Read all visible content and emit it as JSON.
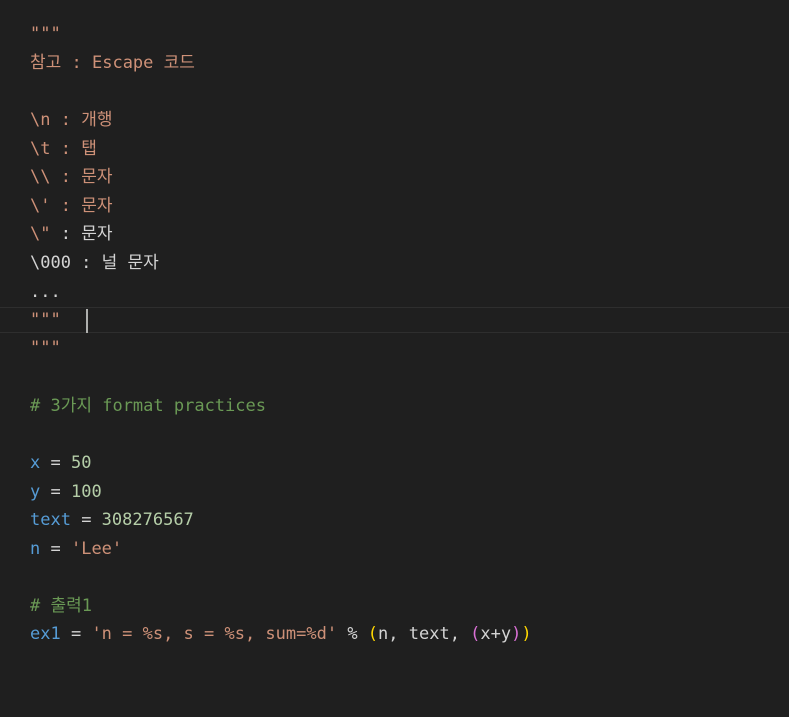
{
  "code": {
    "l1": "\"\"\"",
    "l2": "참고 : Escape 코드",
    "l4a": "\\n : ",
    "l4b": "개행",
    "l5a": "\\t : ",
    "l5b": "탭",
    "l6a": "\\\\ : ",
    "l6b": "문자",
    "l7a": "\\' : ",
    "l7b": "문자",
    "l8a": "\\\"",
    "l8b": " : 문자",
    "l9": "\\000 : 널 문자",
    "l10": "...",
    "l11": "\"\"\"",
    "l12": "\"\"\"",
    "l14": "# 3가지 format practices",
    "l16_var": "x",
    "l16_op": " = ",
    "l16_val": "50",
    "l17_var": "y",
    "l17_op": " = ",
    "l17_val": "100",
    "l18_var": "text",
    "l18_op": " = ",
    "l18_val": "308276567",
    "l19_var": "n",
    "l19_op": " = ",
    "l19_val": "'Lee'",
    "l21": "# 출력1",
    "l22_var": "ex1",
    "l22_op": " = ",
    "l22_str": "'n = %s, s = %s, sum=%d'",
    "l22_pct": " % ",
    "l22_p1": "(",
    "l22_args": "n, text, ",
    "l22_p2": "(",
    "l22_inner": "x+y",
    "l22_p3": ")",
    "l22_p4": ")"
  }
}
